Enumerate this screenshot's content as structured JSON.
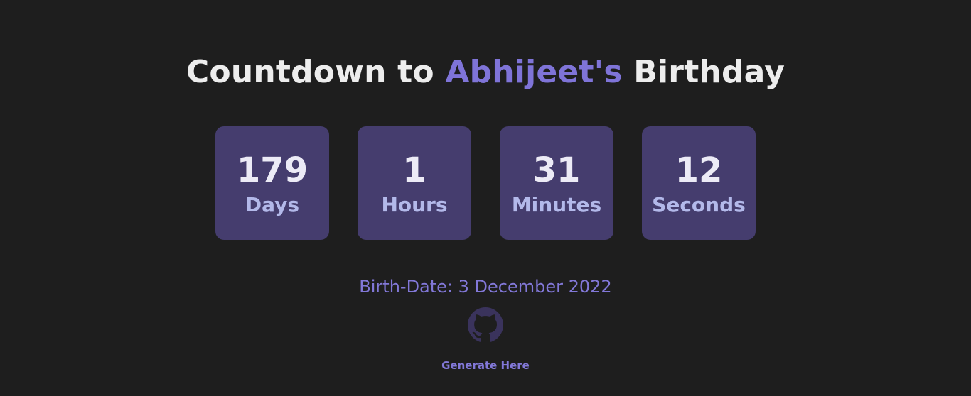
{
  "header": {
    "title_prefix": "Countdown to",
    "name": "Abhijeet's",
    "title_suffix": "Birthday"
  },
  "countdown": [
    {
      "value": "179",
      "label": "Days"
    },
    {
      "value": "1",
      "label": "Hours"
    },
    {
      "value": "31",
      "label": "Minutes"
    },
    {
      "value": "12",
      "label": "Seconds"
    }
  ],
  "birth_date_text": "Birth-Date: 3 December 2022",
  "footer": {
    "github_icon": "github-icon",
    "generate_link": "Generate Here"
  },
  "colors": {
    "background": "#1e1e1e",
    "accent": "#7f74d8",
    "box": "#453d6e",
    "label": "#b3b9ea",
    "icon": "#3a335c"
  }
}
